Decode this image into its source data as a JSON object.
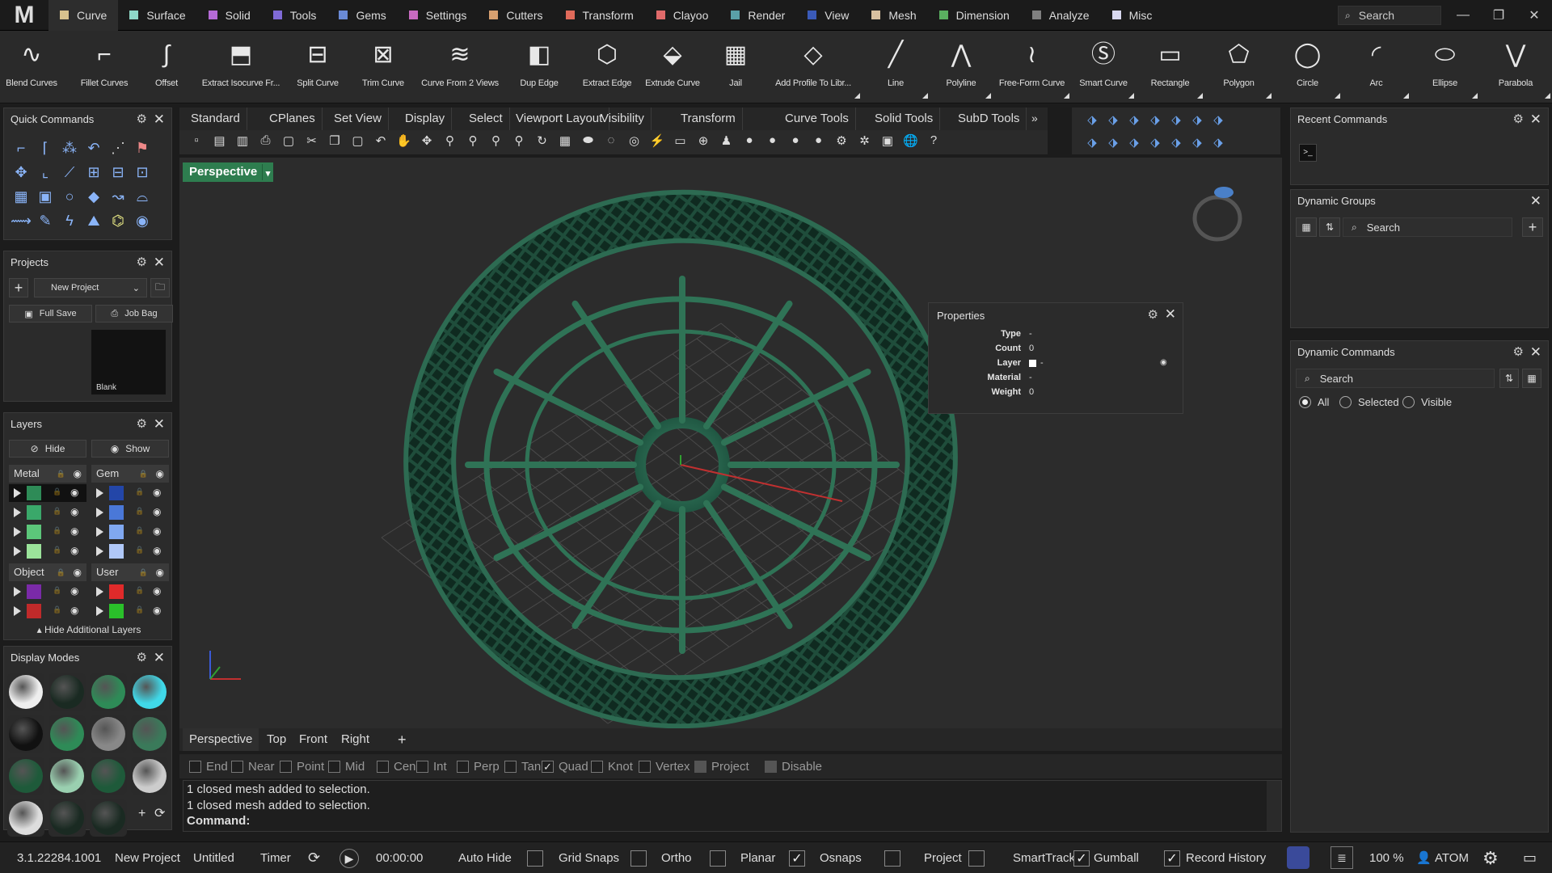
{
  "app": {
    "logo": "M"
  },
  "menu": {
    "tabs": [
      {
        "label": "Curve",
        "color": "#d8c28e"
      },
      {
        "label": "Surface",
        "color": "#8ed8c8"
      },
      {
        "label": "Solid",
        "color": "#b56ad6"
      },
      {
        "label": "Tools",
        "color": "#7f6ad6"
      },
      {
        "label": "Gems",
        "color": "#6a8ad6"
      },
      {
        "label": "Settings",
        "color": "#c86ac0"
      },
      {
        "label": "Cutters",
        "color": "#d8a070"
      },
      {
        "label": "Transform",
        "color": "#e06a5a"
      },
      {
        "label": "Clayoo",
        "color": "#e06a6a"
      },
      {
        "label": "Render",
        "color": "#5aa0a8"
      },
      {
        "label": "View",
        "color": "#3a5ab8"
      },
      {
        "label": "Mesh",
        "color": "#d8c0a0"
      },
      {
        "label": "Dimension",
        "color": "#5ab060"
      },
      {
        "label": "Analyze",
        "color": "#808080"
      },
      {
        "label": "Misc",
        "color": "#d8d8f0"
      }
    ],
    "search_placeholder": "Search"
  },
  "ribbon": {
    "buttons": [
      "Blend Curves",
      "Fillet Curves",
      "Offset",
      "Extract Isocurve Fr...",
      "Split Curve",
      "Trim Curve",
      "Curve From 2 Views",
      "Dup Edge",
      "Extract Edge",
      "Extrude Curve",
      "Jail",
      "Add Profile To Libr...",
      "Line",
      "Polyline",
      "Free-Form Curve",
      "Smart Curve",
      "Rectangle",
      "Polygon",
      "Circle",
      "Arc",
      "Ellipse",
      "Parabola"
    ]
  },
  "quick_commands": {
    "title": "Quick Commands"
  },
  "projects": {
    "title": "Projects",
    "project_select": "New Project",
    "full_save": "Full Save",
    "job_bag": "Job Bag",
    "thumb_label": "Blank"
  },
  "layers": {
    "title": "Layers",
    "hide": "Hide",
    "show": "Show",
    "groups": [
      "Metal",
      "Gem",
      "Object",
      "User"
    ],
    "hide_additional": "Hide Additional Layers",
    "metal_colors": [
      "#2e8b57",
      "#3aa86a",
      "#5cc77a",
      "#9be39a"
    ],
    "gem_colors": [
      "#2346a8",
      "#4a78d8",
      "#80a8f0",
      "#b0c8f8"
    ],
    "object_colors": [
      "#7a2aa8",
      "#c02a2a"
    ],
    "user_colors": [
      "#e02a2a",
      "#2ac02a"
    ]
  },
  "display_modes": {
    "title": "Display Modes"
  },
  "viewport": {
    "tabs": [
      "Standard",
      "CPlanes",
      "Set View",
      "Display",
      "Select",
      "Viewport Layout",
      "Visibility",
      "Transform",
      "Curve Tools",
      "Solid Tools",
      "SubD Tools"
    ],
    "active_view": "Perspective",
    "bottom_tabs": [
      "Perspective",
      "Top",
      "Front",
      "Right"
    ],
    "ring_color": "#2d6b52"
  },
  "properties": {
    "title": "Properties",
    "rows": [
      {
        "key": "Type",
        "value": "-"
      },
      {
        "key": "Count",
        "value": "0"
      },
      {
        "key": "Layer",
        "value": "-"
      },
      {
        "key": "Material",
        "value": "-"
      },
      {
        "key": "Weight",
        "value": "0"
      }
    ]
  },
  "osnaps": [
    {
      "label": "End",
      "checked": false
    },
    {
      "label": "Near",
      "checked": false
    },
    {
      "label": "Point",
      "checked": false
    },
    {
      "label": "Mid",
      "checked": false
    },
    {
      "label": "Cen",
      "checked": false
    },
    {
      "label": "Int",
      "checked": false
    },
    {
      "label": "Perp",
      "checked": false
    },
    {
      "label": "Tan",
      "checked": false
    },
    {
      "label": "Quad",
      "checked": true
    },
    {
      "label": "Knot",
      "checked": false
    },
    {
      "label": "Vertex",
      "checked": false
    },
    {
      "label": "Project",
      "checked": false
    },
    {
      "label": "Disable",
      "checked": false
    }
  ],
  "command": {
    "history": [
      "1 closed mesh added to selection.",
      "1 closed mesh added to selection."
    ],
    "prompt": "Command:"
  },
  "right": {
    "recent_commands": "Recent Commands",
    "dynamic_groups": "Dynamic Groups",
    "dynamic_commands": "Dynamic Commands",
    "search": "Search",
    "radio": [
      {
        "label": "All",
        "checked": true
      },
      {
        "label": "Selected",
        "checked": false
      },
      {
        "label": "Visible",
        "checked": false
      }
    ]
  },
  "status": {
    "version": "3.1.22284.1001",
    "project": "New Project",
    "file": "Untitled",
    "timer_label": "Timer",
    "time": "00:00:00",
    "auto_hide": "Auto Hide",
    "toggles": [
      {
        "label": "Grid Snaps",
        "checked": false
      },
      {
        "label": "Ortho",
        "checked": false
      },
      {
        "label": "Planar",
        "checked": false
      },
      {
        "label": "Osnaps",
        "checked": true
      },
      {
        "label": "Project",
        "checked": false
      },
      {
        "label": "SmartTrack",
        "checked": false
      },
      {
        "label": "Gumball",
        "checked": true
      },
      {
        "label": "Record History",
        "checked": true
      }
    ],
    "zoom": "100 %",
    "user": "ATOM"
  }
}
